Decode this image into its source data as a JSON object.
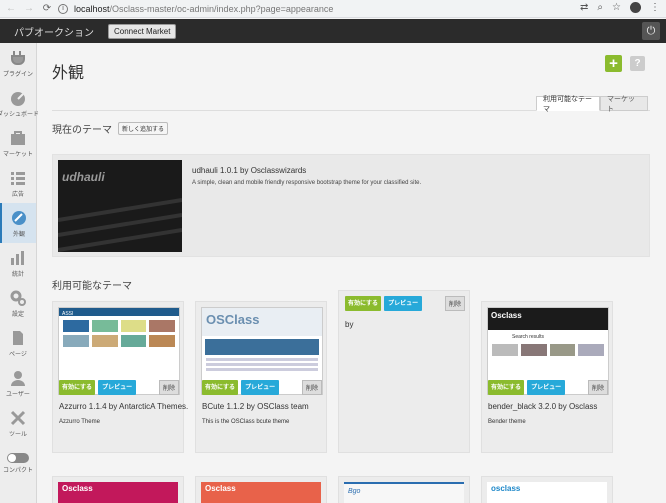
{
  "browser": {
    "url_host": "localhost",
    "url_path": "/Osclass-master/oc-admin/index.php?page=appearance"
  },
  "topbar": {
    "site_title": "パブオークション",
    "connect_label": "Connect Market"
  },
  "sidebar": {
    "items": [
      {
        "label": "プラグイン",
        "icon": "plug-icon"
      },
      {
        "label": "ダッシュボード",
        "icon": "dashboard-icon"
      },
      {
        "label": "マーケット",
        "icon": "market-icon"
      },
      {
        "label": "広告",
        "icon": "list-icon"
      },
      {
        "label": "外観",
        "icon": "appearance-icon",
        "active": true
      },
      {
        "label": "統計",
        "icon": "stats-icon"
      },
      {
        "label": "設定",
        "icon": "settings-icon"
      },
      {
        "label": "ページ",
        "icon": "pages-icon"
      },
      {
        "label": "ユーザー",
        "icon": "user-icon"
      },
      {
        "label": "ツール",
        "icon": "tools-icon"
      },
      {
        "label": "コンパクト",
        "icon": "toggle-icon"
      }
    ]
  },
  "main": {
    "title": "外観",
    "tabs": [
      {
        "label": "利用可能なテーマ",
        "active": true
      },
      {
        "label": "マーケット",
        "active": false
      }
    ],
    "current_heading": "現在のテーマ",
    "add_new_label": "新しく追加する",
    "current_theme": {
      "logo_text": "udhauli",
      "name": "udhauli 1.0.1 by Osclasswizards",
      "description": "A simple, clean and mobile friendly responsive bootstrap theme for your classified site."
    },
    "available_heading": "利用可能なテーマ",
    "activate_label": "有効にする",
    "preview_label": "プレビュー",
    "delete_label": "削除",
    "themes": [
      {
        "name": "Azzurro 1.1.4 by AntarcticA Themes.",
        "description": "Azzurro Theme",
        "thumb_logo": "ASSI"
      },
      {
        "name": "BCute 1.1.2 by OSClass team",
        "description": "This is the OSClass bcute theme",
        "thumb_logo": "OSClass"
      },
      {
        "name": "by",
        "description": ""
      },
      {
        "name": "bender_black 3.2.0 by Osclass",
        "description": "Bender theme",
        "thumb_logo": "Osclass",
        "thumb_search": "Search results"
      }
    ],
    "bottom_themes": [
      {
        "thumb_logo": "Osclass"
      },
      {
        "thumb_logo": "Osclass"
      },
      {
        "thumb_logo": "Bgo"
      },
      {
        "thumb_logo": "osclass"
      }
    ]
  }
}
